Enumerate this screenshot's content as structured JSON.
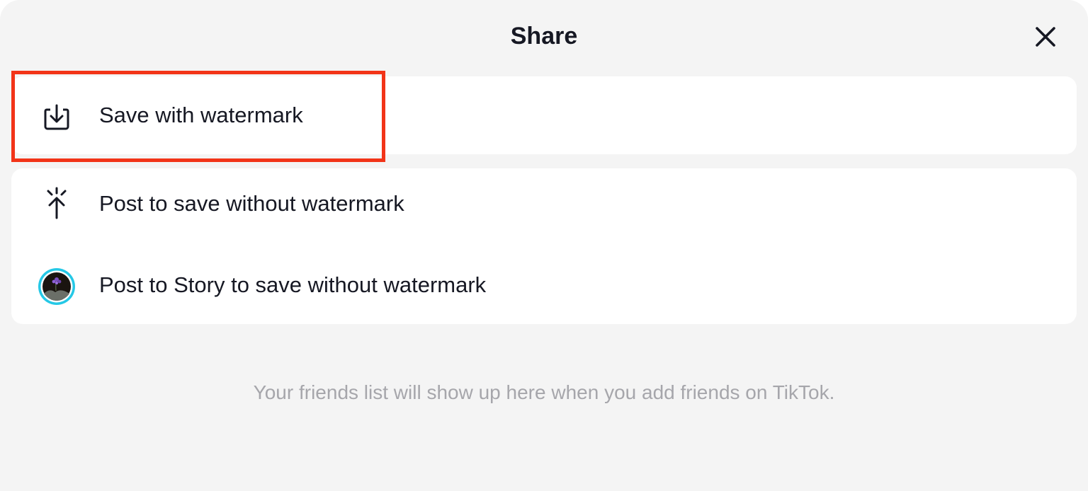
{
  "header": {
    "title": "Share",
    "close_icon": "close-icon"
  },
  "options": {
    "save_with_watermark": {
      "label": "Save with watermark",
      "icon": "download-icon"
    },
    "post_without_watermark": {
      "label": "Post to save without watermark",
      "icon": "sparkle-arrow-icon"
    },
    "story_without_watermark": {
      "label": "Post to Story to save without watermark",
      "icon": "story-avatar-icon"
    }
  },
  "friends": {
    "empty_message": "Your friends list will show up here when you add friends on TikTok."
  },
  "colors": {
    "sheet_background": "#f4f4f4",
    "card_background": "#ffffff",
    "text_primary": "#161823",
    "text_secondary": "#a6a6ab",
    "highlight_border": "#f23418",
    "story_ring": "#25c8e6"
  }
}
